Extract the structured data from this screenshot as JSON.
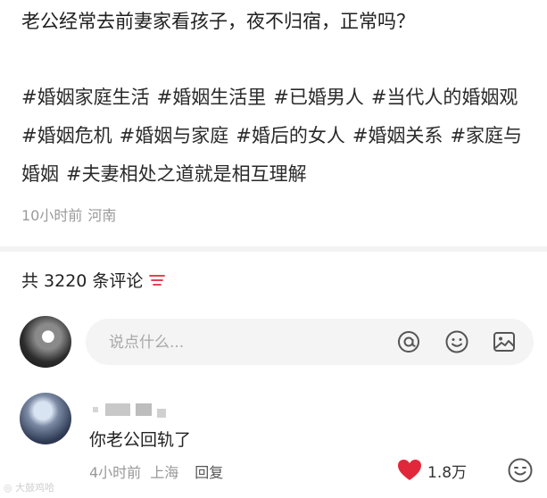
{
  "post": {
    "title": "老公经常去前妻家看孩子，夜不归宿，正常吗？",
    "tags": [
      "#婚姻家庭生活",
      "#婚姻生活里",
      "#已婚男人",
      "#当代人的婚姻观",
      "#婚姻危机",
      "#婚姻与家庭",
      "#婚后的女人",
      "#婚姻关系",
      "#家庭与婚姻",
      "#夫妻相处之道就是相互理解"
    ],
    "time": "10小时前",
    "location": "河南"
  },
  "comments_header": {
    "count_label": "共 3220 条评论",
    "sort_icon": "sort-lines-icon"
  },
  "comment_input": {
    "placeholder": "说点什么...",
    "icons": [
      "at-icon",
      "emoji-icon",
      "image-icon"
    ]
  },
  "comments": [
    {
      "text": "你老公回轨了",
      "time": "4小时前",
      "location": "上海",
      "reply_label": "回复",
      "likes": "1.8万",
      "like_color": "#e0283a"
    }
  ],
  "colors": {
    "accent": "#e0283a",
    "meta": "#9a9a9a",
    "input_bg": "#f4f4f4"
  }
}
